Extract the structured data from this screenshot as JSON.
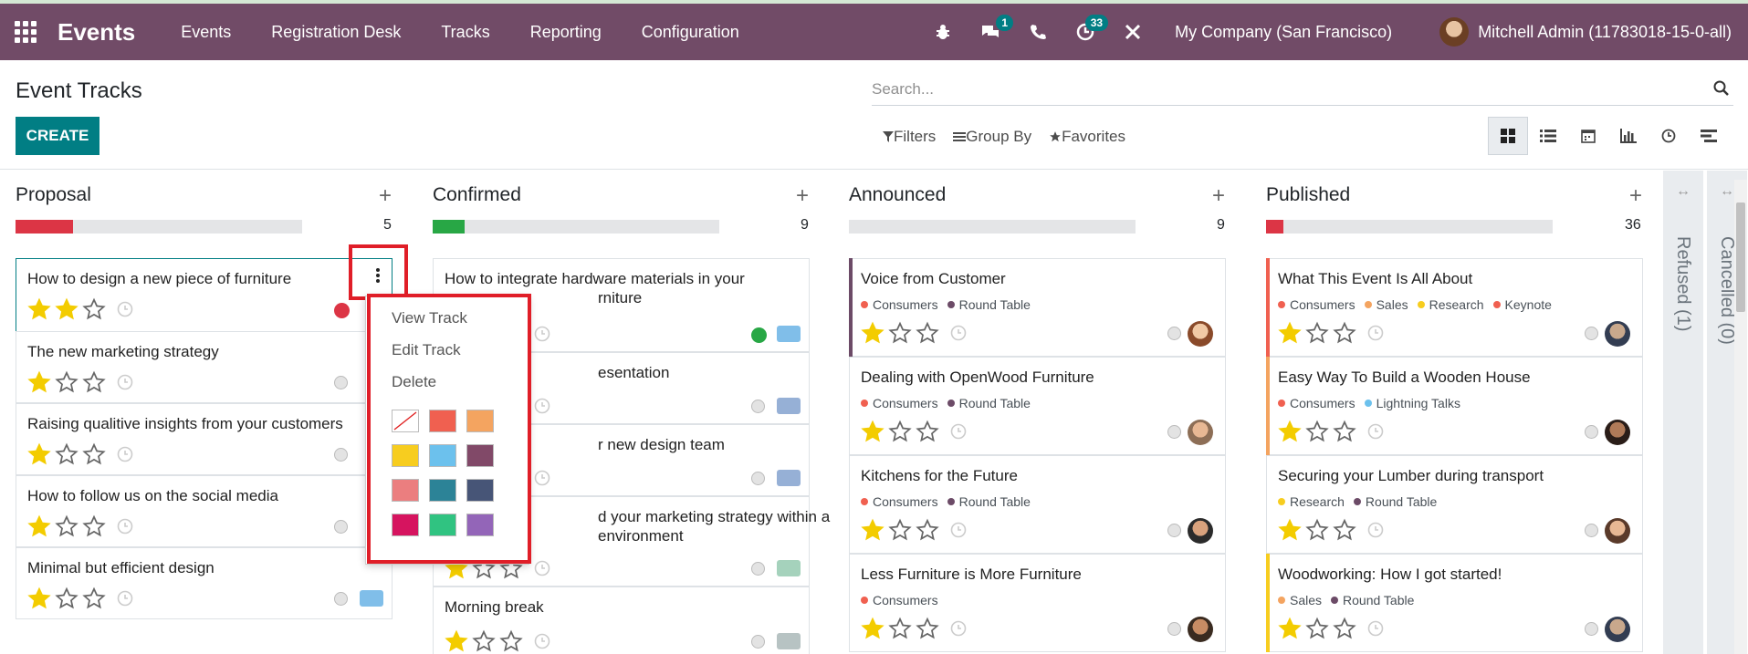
{
  "navbar": {
    "app_title": "Events",
    "menu": [
      "Events",
      "Registration Desk",
      "Tracks",
      "Reporting",
      "Configuration"
    ],
    "messages_badge": "1",
    "activities_badge": "33",
    "company": "My Company (San Francisco)",
    "user": "Mitchell Admin (11783018-15-0-all)"
  },
  "control_panel": {
    "title": "Event Tracks",
    "create_label": "CREATE",
    "search_placeholder": "Search...",
    "filters_label": "Filters",
    "groupby_label": "Group By",
    "favorites_label": "Favorites"
  },
  "columns": [
    {
      "title": "Proposal",
      "count": "5",
      "progress_color": "#dc3545",
      "progress": 0.2
    },
    {
      "title": "Confirmed",
      "count": "9",
      "progress_color": "#28a745",
      "progress": 0.11
    },
    {
      "title": "Announced",
      "count": "9",
      "progress_color": "#dc3545",
      "progress": 0
    },
    {
      "title": "Published",
      "count": "36",
      "progress_color": "#dc3545",
      "progress": 0.06
    }
  ],
  "proposal_cards": [
    {
      "name": "How to design a new piece of furniture",
      "stars": 2,
      "status": "red"
    },
    {
      "name": "The new marketing strategy",
      "stars": 1,
      "status": "grey"
    },
    {
      "name": "Raising qualitive insights from your customers",
      "stars": 1,
      "status": "grey"
    },
    {
      "name": "How to follow us on the social media",
      "stars": 1,
      "status": "grey"
    },
    {
      "name": "Minimal but efficient design",
      "stars": 1,
      "status": "grey"
    }
  ],
  "confirmed_cards": [
    {
      "name_line1": "How to integrate hardware materials in your",
      "name_line2": "rniture",
      "stars": 0,
      "status": "green"
    },
    {
      "name_line1": "esentation",
      "stars": 0,
      "status": "grey"
    },
    {
      "name_line1": "r new design team",
      "stars": 0,
      "status": "grey"
    },
    {
      "name_line1": "d your marketing strategy within a",
      "name_line2": "environment",
      "stars": 1,
      "status": "grey"
    },
    {
      "name_line1": "Morning break",
      "stars": 1,
      "status": "grey"
    }
  ],
  "announced_cards": [
    {
      "name": "Voice from Customer",
      "tags": [
        "Consumers",
        "Round Table"
      ],
      "stars": 1
    },
    {
      "name": "Dealing with OpenWood Furniture",
      "tags": [
        "Consumers",
        "Round Table"
      ],
      "stars": 1
    },
    {
      "name": "Kitchens for the Future",
      "tags": [
        "Consumers",
        "Round Table"
      ],
      "stars": 1
    },
    {
      "name": "Less Furniture is More Furniture",
      "tags": [
        "Consumers"
      ],
      "stars": 1
    }
  ],
  "published_cards": [
    {
      "name": "What This Event Is All About",
      "tags": [
        "Consumers",
        "Sales",
        "Research",
        "Keynote"
      ],
      "stars": 1
    },
    {
      "name": "Easy Way To Build a Wooden House",
      "tags": [
        "Consumers",
        "Lightning Talks"
      ],
      "stars": 1
    },
    {
      "name": "Securing your Lumber during transport",
      "tags": [
        "Research",
        "Round Table"
      ],
      "stars": 1
    },
    {
      "name": "Woodworking: How I got started!",
      "tags": [
        "Sales",
        "Round Table"
      ],
      "stars": 1
    }
  ],
  "tag_colors": {
    "Consumers": "#f06050",
    "Round Table": "#6c4b67",
    "Sales": "#f4a460",
    "Research": "#f7cd1f",
    "Keynote": "#f06050",
    "Lightning Talks": "#6cc1ed"
  },
  "folded_columns": [
    "Refused (1)",
    "Cancelled (0)"
  ],
  "dropdown": {
    "items": [
      "View Track",
      "Edit Track",
      "Delete"
    ],
    "swatches": [
      "none",
      "#f06050",
      "#f4a460",
      "#f7cd1f",
      "#6cc1ed",
      "#814968",
      "#eb7e7f",
      "#2c8397",
      "#475577",
      "#d6145f",
      "#30c381",
      "#9365b8"
    ]
  }
}
